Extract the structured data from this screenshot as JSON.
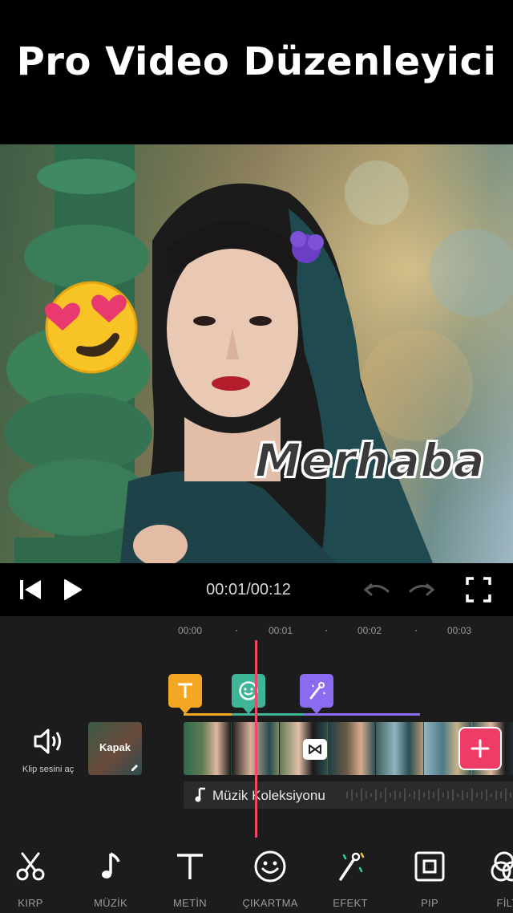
{
  "header": {
    "title": "Pro Video Düzenleyici"
  },
  "preview": {
    "overlay_text": "Merhaba",
    "emoji_sticker": "heart-eyes-emoji"
  },
  "player": {
    "time": "00:01/00:12",
    "icons": [
      "skip-back-icon",
      "play-icon",
      "undo-icon",
      "redo-icon",
      "fullscreen-icon"
    ]
  },
  "timeline": {
    "ticks": [
      "00:00",
      "00:01",
      "00:02",
      "00:03"
    ],
    "markers": [
      {
        "icon": "text-icon",
        "color": "#f5a623"
      },
      {
        "icon": "sticker-icon",
        "color": "#3fb597"
      },
      {
        "icon": "effect-wand-icon",
        "color": "#8b6cf0"
      }
    ],
    "clip_sound_label": "Klip sesini aç",
    "cover_label": "Kapak",
    "music_label": "Müzik Koleksiyonu",
    "add_button_color": "#ef3c66"
  },
  "toolbar": {
    "items": [
      {
        "label": "KIRP",
        "icon": "scissors-icon"
      },
      {
        "label": "MÜZİK",
        "icon": "music-note-icon"
      },
      {
        "label": "METİN",
        "icon": "text-icon"
      },
      {
        "label": "ÇIKARTMA",
        "icon": "smiley-icon"
      },
      {
        "label": "EFEKT",
        "icon": "magic-wand-icon"
      },
      {
        "label": "PIP",
        "icon": "pip-icon"
      },
      {
        "label": "FİLT",
        "icon": "filter-icon"
      }
    ]
  },
  "colors": {
    "accent": "#ef3c66",
    "playhead": "#f0466a",
    "background": "#1c1c1c"
  }
}
